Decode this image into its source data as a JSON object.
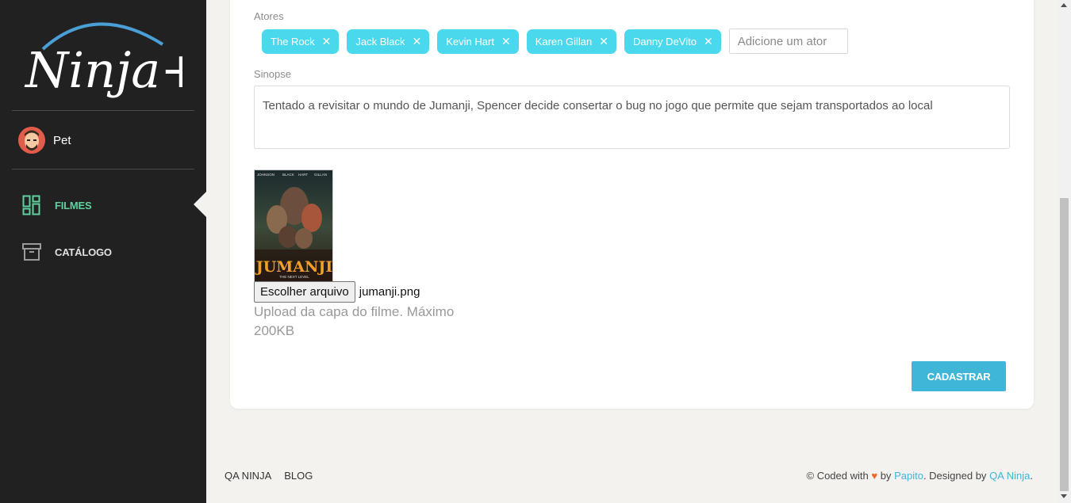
{
  "sidebar": {
    "logo_text": "Ninja+",
    "user": {
      "name": "Pet"
    },
    "nav": [
      {
        "label": "FILMES",
        "icon": "dashboard-icon",
        "active": true
      },
      {
        "label": "CATÁLOGO",
        "icon": "archive-box-icon",
        "active": false
      }
    ]
  },
  "form": {
    "actors_label": "Atores",
    "actors": [
      "The Rock",
      "Jack Black",
      "Kevin Hart",
      "Karen Gillan",
      "Danny DeVito"
    ],
    "actor_input_placeholder": "Adicione um ator",
    "synopsis_label": "Sinopse",
    "synopsis_value": "Tentado a revisitar o mundo de Jumanji, Spencer decide consertar o bug no jogo que permite que sejam transportados ao local",
    "poster": {
      "top_names": [
        "JOHNSON",
        "BLACK",
        "HART",
        "GILLAN"
      ],
      "title": "JUMANJI",
      "subtitle": "THE NEXT LEVEL"
    },
    "file_button_label": "Escolher arquivo",
    "file_name": "jumanji.png",
    "upload_help": "Upload da capa do filme. Máximo 200KB",
    "submit_label": "CADASTRAR"
  },
  "footer": {
    "links": [
      "QA NINJA",
      "BLOG"
    ],
    "credits": {
      "prefix": "© Coded with",
      "by": "by",
      "author": "Papito",
      "designed": ". Designed by",
      "designer": "QA Ninja",
      "suffix": "."
    }
  },
  "colors": {
    "sidebar_bg": "#212121",
    "accent_green": "#5fd19e",
    "tag_bg": "#4ad8ed",
    "button_bg": "#3fb6d8",
    "heart": "#f26522"
  }
}
